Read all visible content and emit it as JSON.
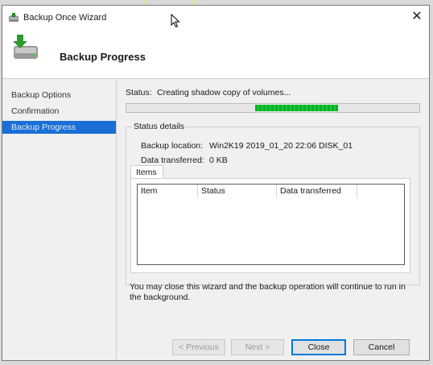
{
  "window": {
    "title": "Backup Once Wizard",
    "close_glyph": "✕",
    "app_icon": "backup-app-icon"
  },
  "header": {
    "heading": "Backup Progress",
    "icon": "backup-wizard-icon"
  },
  "nav": {
    "items": [
      {
        "label": "Backup Options",
        "active": false
      },
      {
        "label": "Confirmation",
        "active": false
      },
      {
        "label": "Backup Progress",
        "active": true
      }
    ]
  },
  "status": {
    "label": "Status:",
    "value": "Creating shadow copy of volumes...",
    "progress_color": "#06b025"
  },
  "details": {
    "legend": "Status details",
    "location_label": "Backup location:",
    "location_value": "Win2K19 2019_01_20 22:06 DISK_01",
    "transferred_label": "Data transferred:",
    "transferred_value": "0 KB",
    "tab": "Items",
    "columns": [
      "Item",
      "Status",
      "Data transferred"
    ]
  },
  "note": "You may close this wizard and the backup operation will continue to run in the background.",
  "buttons": {
    "previous": "< Previous",
    "next": "Next >",
    "close": "Close",
    "cancel": "Cancel"
  }
}
